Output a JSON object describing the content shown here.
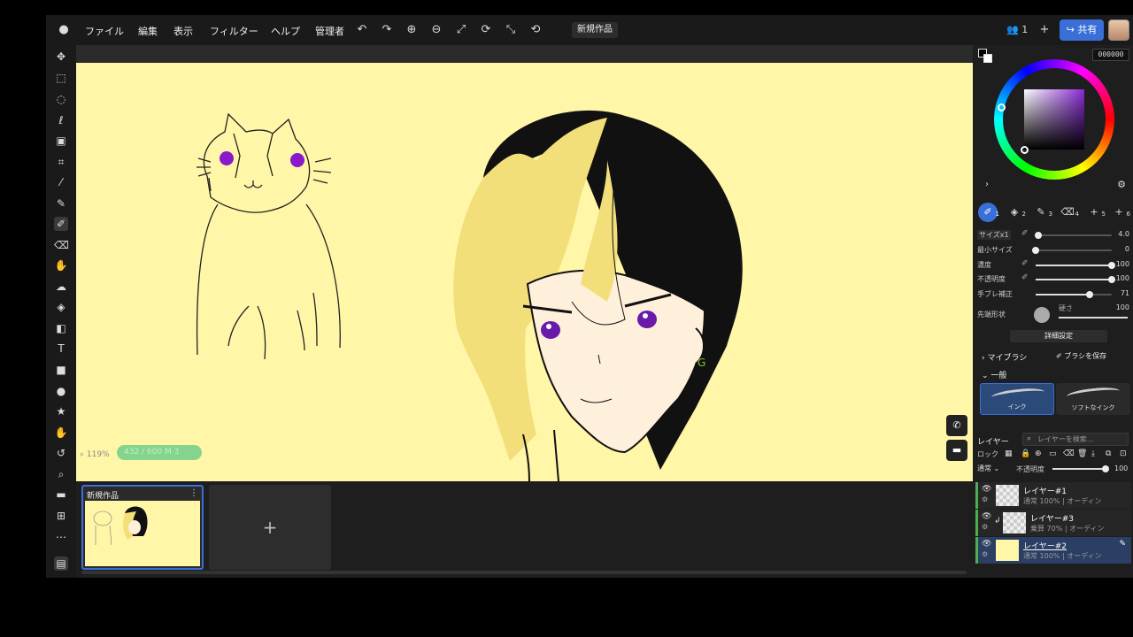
{
  "menu": {
    "items": [
      "ファイル",
      "編集",
      "表示",
      "フィルター",
      "ヘルプ",
      "管理者"
    ],
    "document_title": "新規作品"
  },
  "header": {
    "user_count": "1",
    "share_label": "共有"
  },
  "canvas": {
    "zoom": "119%",
    "position": "432 / 600",
    "position_extra": "M 3"
  },
  "thumbnails": {
    "title": "新規作品",
    "add_symbol": "+"
  },
  "color": {
    "hex": "000000",
    "current": "#000000",
    "hue_color": "#8a2ad6"
  },
  "brush_tabs": [
    {
      "num": "1",
      "icon": "brush-icon"
    },
    {
      "num": "2",
      "icon": "fill-icon"
    },
    {
      "num": "3",
      "icon": "pen-icon"
    },
    {
      "num": "4",
      "icon": "eraser-icon"
    },
    {
      "num": "5",
      "icon": "plus-icon"
    },
    {
      "num": "6",
      "icon": "plus-icon"
    }
  ],
  "brush_params": {
    "size": {
      "label": "サイズx1",
      "value": "4.0",
      "level": 0.03
    },
    "min_size": {
      "label": "最小サイズ",
      "value": "0",
      "level": 0.0
    },
    "density": {
      "label": "濃度",
      "value": "100",
      "level": 1.0
    },
    "opacity": {
      "label": "不透明度",
      "value": "100",
      "level": 1.0
    },
    "stabilizer": {
      "label": "手ブレ補正",
      "value": "71",
      "level": 0.71
    },
    "tip_shape_label": "先端形状",
    "hardness_label": "硬さ",
    "hardness_value": "100",
    "detail_label": "詳細設定"
  },
  "brush_library": {
    "my_brush_label": "マイブラシ",
    "save_label": "ブラシを保存",
    "general_label": "一般",
    "brushes": [
      "インク",
      "ソフトなインク"
    ]
  },
  "layers": {
    "header": "レイヤー",
    "search_placeholder": "レイヤーを検索...",
    "lock_label": "ロック",
    "blend_mode": "通常",
    "opacity_label": "不透明度",
    "opacity_value": "100",
    "items": [
      {
        "name": "レイヤー#1",
        "info": "通常 100% | オーディン"
      },
      {
        "name": "レイヤー#3",
        "info": "乗算 70% | オーディン"
      },
      {
        "name": "レイヤー#2",
        "info": "通常 100% | オーディン"
      }
    ]
  }
}
